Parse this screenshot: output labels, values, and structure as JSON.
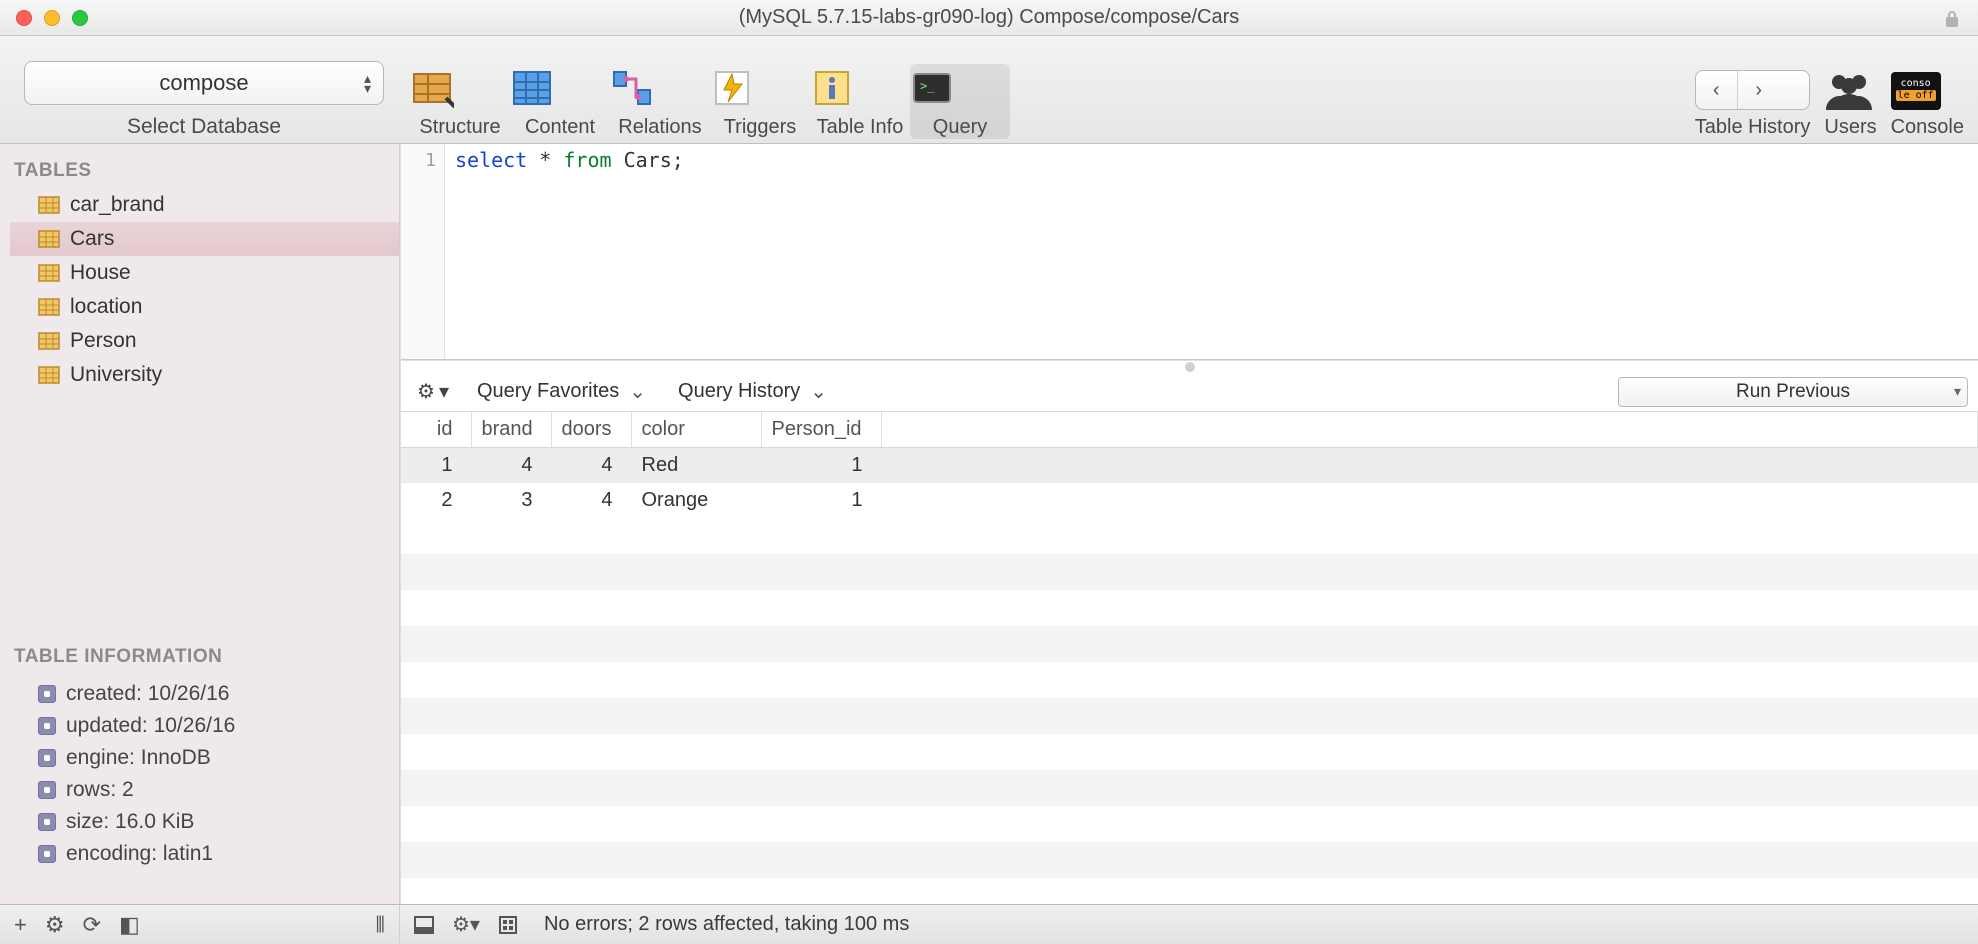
{
  "window": {
    "title": "(MySQL 5.7.15-labs-gr090-log) Compose/compose/Cars"
  },
  "toolbar": {
    "database_selector_value": "compose",
    "database_selector_caption": "Select Database",
    "items": [
      {
        "label": "Structure"
      },
      {
        "label": "Content"
      },
      {
        "label": "Relations"
      },
      {
        "label": "Triggers"
      },
      {
        "label": "Table Info"
      },
      {
        "label": "Query",
        "active": true
      }
    ],
    "history_nav": {
      "back": "‹",
      "forward": "›"
    },
    "table_history_label": "Table History",
    "users_label": "Users",
    "console_label": "Console",
    "console_badge_line1": "conso",
    "console_badge_line2": "le off"
  },
  "sidebar": {
    "tables_header": "TABLES",
    "tables": [
      {
        "name": "car_brand"
      },
      {
        "name": "Cars",
        "selected": true
      },
      {
        "name": "House"
      },
      {
        "name": "location"
      },
      {
        "name": "Person"
      },
      {
        "name": "University"
      }
    ],
    "info_header": "TABLE INFORMATION",
    "info": [
      {
        "text": "created: 10/26/16"
      },
      {
        "text": "updated: 10/26/16"
      },
      {
        "text": "engine: InnoDB"
      },
      {
        "text": "rows: 2"
      },
      {
        "text": "size: 16.0 KiB"
      },
      {
        "text": "encoding: latin1"
      }
    ],
    "bottom_buttons": {
      "add": "+",
      "gear": "⚙",
      "refresh": "⟳",
      "pane": "◧",
      "cols": "⦀"
    }
  },
  "editor": {
    "line_numbers": [
      "1"
    ],
    "tokens": [
      {
        "t": "select",
        "cls": "kw-blue"
      },
      {
        "t": " * ",
        "cls": ""
      },
      {
        "t": "from",
        "cls": "kw-green"
      },
      {
        "t": " Cars;",
        "cls": ""
      }
    ]
  },
  "controls": {
    "gear": "⚙",
    "favorites_label": "Query Favorites",
    "history_label": "Query History",
    "run_previous_label": "Run Previous"
  },
  "results": {
    "columns": [
      "id",
      "brand",
      "doors",
      "color",
      "Person_id"
    ],
    "rows": [
      {
        "id": 1,
        "brand": 4,
        "doors": 4,
        "color": "Red",
        "Person_id": 1
      },
      {
        "id": 2,
        "brand": 3,
        "doors": 4,
        "color": "Orange",
        "Person_id": 1
      }
    ]
  },
  "status": {
    "text": "No errors; 2 rows affected, taking 100 ms"
  },
  "chart_data": {
    "type": "table",
    "title": "Cars query result",
    "columns": [
      "id",
      "brand",
      "doors",
      "color",
      "Person_id"
    ],
    "rows": [
      [
        1,
        4,
        4,
        "Red",
        1
      ],
      [
        2,
        3,
        4,
        "Orange",
        1
      ]
    ]
  }
}
